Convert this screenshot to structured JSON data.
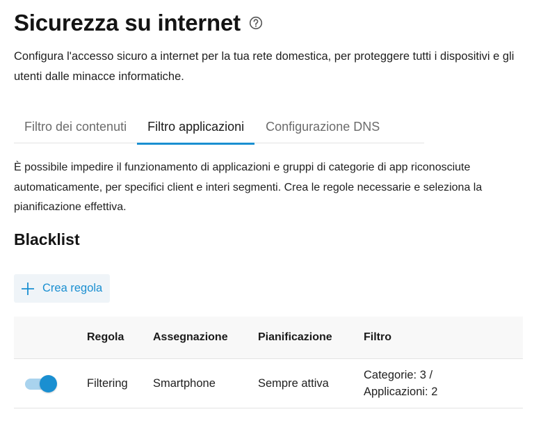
{
  "header": {
    "title": "Sicurezza su internet",
    "help_icon": "question-circle-icon",
    "intro": "Configura l'accesso sicuro a internet per la tua rete domestica, per proteggere tutti i dispositivi e gli utenti dalle minacce informatiche."
  },
  "tabs": [
    {
      "label": "Filtro dei contenuti",
      "active": false
    },
    {
      "label": "Filtro applicazioni",
      "active": true
    },
    {
      "label": "Configurazione DNS",
      "active": false
    }
  ],
  "description": "È possibile impedire il funzionamento di applicazioni e gruppi di categorie di app riconosciute automaticamente, per specifici client e interi segmenti. Crea le regole necessarie e seleziona la pianificazione effettiva.",
  "blacklist": {
    "title": "Blacklist",
    "create_button": {
      "icon": "plus-icon",
      "label": "Crea regola"
    },
    "columns": [
      "Regola",
      "Assegnazione",
      "Pianificazione",
      "Filtro"
    ],
    "rows": [
      {
        "enabled": true,
        "regola": "Filtering",
        "assegnazione": "Smartphone",
        "pianificazione": "Sempre attiva",
        "filtro_line1": "Categorie: 3 /",
        "filtro_line2": "Applicazioni: 2"
      }
    ]
  },
  "colors": {
    "accent": "#1a8fd1",
    "toggle_track": "#a9d3ee",
    "button_bg": "#eff4f8",
    "header_bg": "#f8f8f8"
  }
}
